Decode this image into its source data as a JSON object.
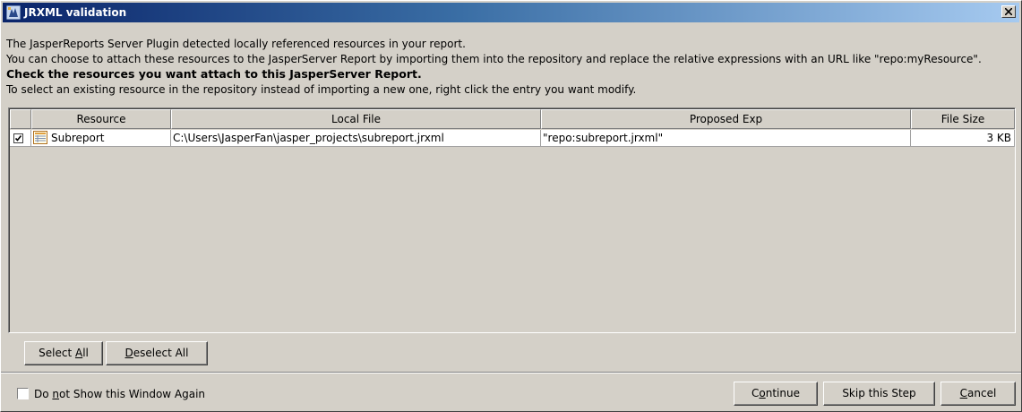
{
  "window": {
    "title": "JRXML validation"
  },
  "message": {
    "line1": "The JasperReports Server Plugin detected locally referenced resources in your report.",
    "line2": "You can choose to attach these resources to the JasperServer Report by importing them into the repository and replace the relative expressions with an URL like \"repo:myResource\".",
    "line3": "Check the resources you want attach to this JasperServer Report.",
    "line4": "To select an existing resource in the repository instead of importing a new one, right click the entry you want modify."
  },
  "table": {
    "columns": [
      "",
      "Resource",
      "Local File",
      "Proposed Exp",
      "File Size"
    ],
    "rows": [
      {
        "checked": true,
        "resource": "Subreport",
        "local_file": "C:\\Users\\JasperFan\\jasper_projects\\subreport.jrxml",
        "proposed_exp": "\"repo:subreport.jrxml\"",
        "file_size": "3 KB"
      }
    ]
  },
  "buttons": {
    "select_all_pre": "Select ",
    "select_all_key": "A",
    "select_all_post": "ll",
    "deselect_all_pre": "",
    "deselect_all_key": "D",
    "deselect_all_post": "eselect All",
    "continue_pre": "C",
    "continue_key": "o",
    "continue_post": "ntinue",
    "skip": "Skip this Step",
    "cancel_pre": "",
    "cancel_key": "C",
    "cancel_post": "ancel"
  },
  "footer": {
    "dont_show_pre": "Do ",
    "dont_show_key": "n",
    "dont_show_post": "ot Show this Window Again",
    "dont_show_checked": false
  },
  "icons": {
    "app": "jasper-app-icon",
    "close": "close-icon",
    "checkbox": "checkbox-checked-icon",
    "resource": "subreport-icon"
  },
  "colors": {
    "title_start": "#0a246a",
    "title_end": "#a6caf0",
    "face": "#d4d0c8"
  }
}
